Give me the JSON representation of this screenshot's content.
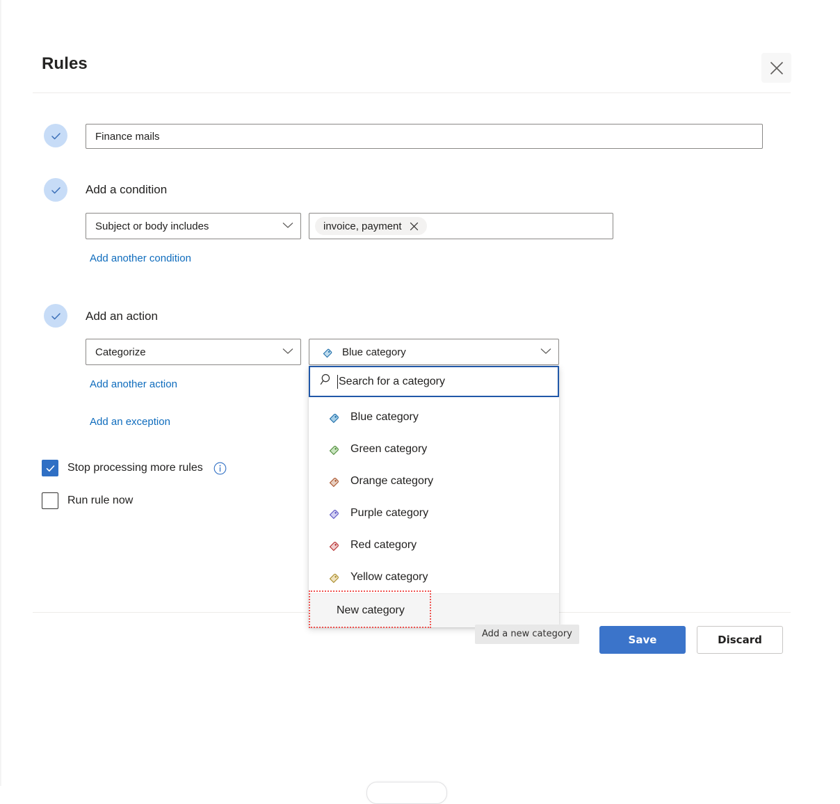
{
  "header": {
    "title": "Rules",
    "close_icon": "close-icon"
  },
  "rule_name": {
    "value": "Finance mails",
    "placeholder": "Name"
  },
  "condition_section": {
    "label": "Add a condition",
    "select_value": "Subject or body includes",
    "pill_text": "invoice, payment",
    "pill_remove_icon": "close-icon",
    "add_another_label": "Add another condition"
  },
  "action_section": {
    "label": "Add an action",
    "select_value": "Categorize",
    "category_value": "Blue category",
    "add_another_label": "Add another action",
    "add_exception_label": "Add an exception"
  },
  "category_dropdown": {
    "search_placeholder": "Search for a category",
    "search_value": "",
    "search_icon": "search-icon",
    "items": [
      {
        "label": "Blue category",
        "color": "#a6cfe8",
        "stroke": "#1b6ca8"
      },
      {
        "label": "Green category",
        "color": "#c9e5c0",
        "stroke": "#4e8b39"
      },
      {
        "label": "Orange category",
        "color": "#e8cfc0",
        "stroke": "#a8522a"
      },
      {
        "label": "Purple category",
        "color": "#d3d1f2",
        "stroke": "#5b53c4"
      },
      {
        "label": "Red category",
        "color": "#f0cdcd",
        "stroke": "#b52c2c"
      },
      {
        "label": "Yellow category",
        "color": "#f0e3be",
        "stroke": "#a88b2a"
      }
    ],
    "new_category_label": "New category",
    "tooltip": "Add a new category"
  },
  "options": {
    "stop_processing": {
      "label": "Stop processing more rules",
      "checked": true,
      "info_icon": "info-icon"
    },
    "run_rule_now": {
      "label": "Run rule now",
      "checked": false
    }
  },
  "footer": {
    "save_label": "Save",
    "discard_label": "Discard"
  },
  "colors": {
    "accent": "#0f6cbd",
    "primary_button": "#3b74ca",
    "focus_border": "#2158a8",
    "highlight": "#ef5350"
  }
}
